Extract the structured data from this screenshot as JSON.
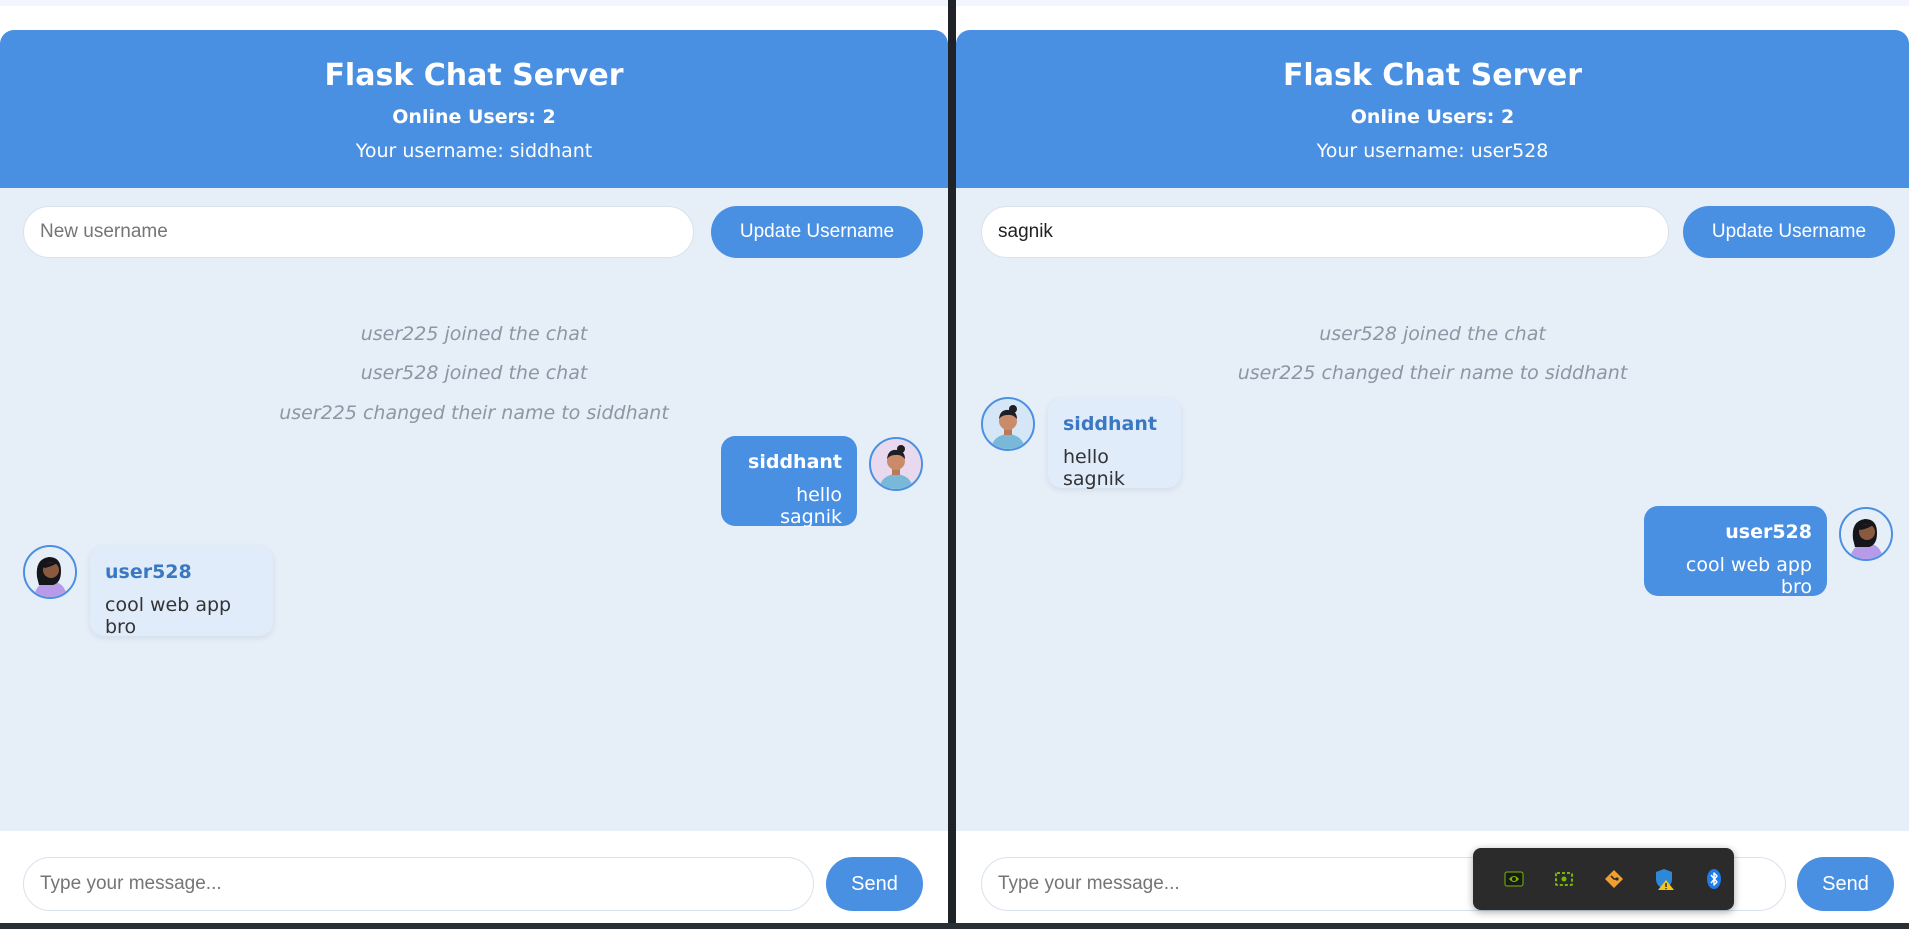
{
  "windows": [
    {
      "title": "Flask Chat Server",
      "online_users": "Online Users: 2",
      "your_username": "Your username: siddhant",
      "username_input": {
        "value": "",
        "placeholder": "New username"
      },
      "update_button": "Update Username",
      "system_messages": [
        "user225 joined the chat",
        "user528 joined the chat",
        "user225 changed their name to siddhant"
      ],
      "messages": [
        {
          "direction": "sent",
          "user": "siddhant",
          "text": "hello sagnik",
          "avatar_icon": "male-avatar-icon"
        },
        {
          "direction": "received",
          "user": "user528",
          "text": "cool web app bro",
          "avatar_icon": "female-avatar-icon"
        }
      ],
      "message_input": {
        "value": "",
        "placeholder": "Type your message..."
      },
      "send_button": "Send"
    },
    {
      "title": "Flask Chat Server",
      "online_users": "Online Users: 2",
      "your_username": "Your username: user528",
      "username_input": {
        "value": "sagnik",
        "placeholder": "New username"
      },
      "update_button": "Update Username",
      "system_messages": [
        "user528 joined the chat",
        "user225 changed their name to siddhant"
      ],
      "messages": [
        {
          "direction": "received",
          "user": "siddhant",
          "text": "hello sagnik",
          "avatar_icon": "male-avatar-icon"
        },
        {
          "direction": "sent",
          "user": "user528",
          "text": "cool web app bro",
          "avatar_icon": "female-avatar-icon"
        }
      ],
      "message_input": {
        "value": "",
        "placeholder": "Type your message..."
      },
      "send_button": "Send"
    }
  ],
  "system_tray": {
    "icons": [
      "nvidia-icon",
      "nvidia-broadcast-icon",
      "git-icon",
      "windows-security-warning-icon",
      "bluetooth-icon"
    ]
  },
  "colors": {
    "accent": "#4a90e2",
    "chat_background": "#e6eef7",
    "received_bubble": "#e1ecfb",
    "system_text": "#8c96a4"
  }
}
